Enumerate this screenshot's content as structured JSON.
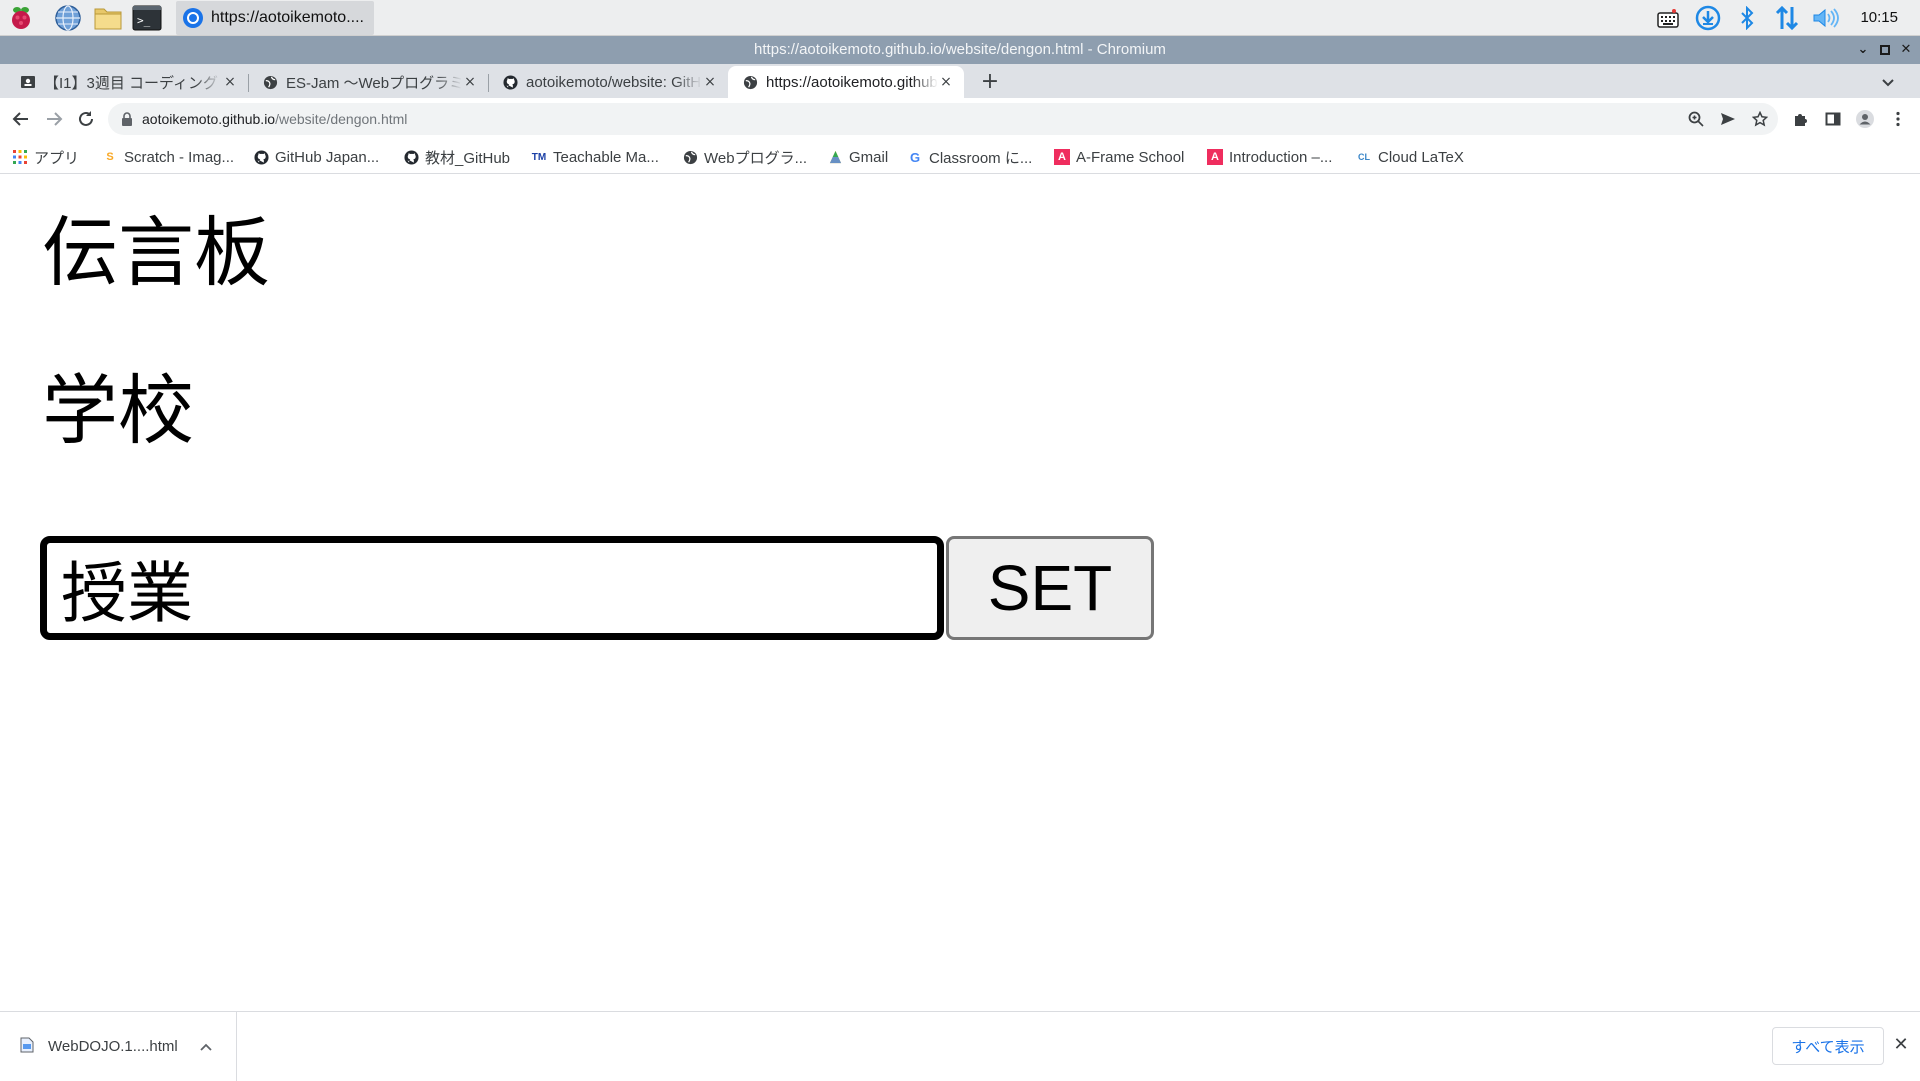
{
  "taskbar": {
    "launchers": [
      "raspberry-menu-icon",
      "web-browser-icon",
      "file-manager-icon",
      "terminal-icon"
    ],
    "active_task": "https://aotoikemoto....",
    "clock": "10:15"
  },
  "window": {
    "title": "https://aotoikemoto.github.io/website/dengon.html - Chromium"
  },
  "tabs": [
    {
      "title": "【I1】3週目 コーディング",
      "close": "×"
    },
    {
      "title": "ES-Jam 〜Webプログラミング",
      "close": "×"
    },
    {
      "title": "aotoikemoto/website: GitHub",
      "close": "×"
    },
    {
      "title": "https://aotoikemoto.github.io",
      "close": "×"
    }
  ],
  "new_tab_label": "+",
  "omnibox": {
    "host": "aotoikemoto.github.io",
    "path": "/website/dengon.html"
  },
  "bookmarks": [
    {
      "label": "アプリ",
      "icon": "apps-grid-icon"
    },
    {
      "label": "Scratch - Imag...",
      "icon": "scratch-icon"
    },
    {
      "label": "GitHub Japan...",
      "icon": "github-icon"
    },
    {
      "label": "教材_GitHub",
      "icon": "github-icon"
    },
    {
      "label": "Teachable Ma...",
      "icon": "teachable-machine-icon"
    },
    {
      "label": "Webプログラ...",
      "icon": "globe-icon"
    },
    {
      "label": "Gmail",
      "icon": "gmail-icon"
    },
    {
      "label": "Classroom に...",
      "icon": "google-icon"
    },
    {
      "label": "A-Frame School",
      "icon": "aframe-icon"
    },
    {
      "label": "Introduction –...",
      "icon": "aframe-icon"
    },
    {
      "label": "Cloud LaTeX",
      "icon": "cloud-latex-icon"
    }
  ],
  "page": {
    "heading": "伝言板",
    "message": "学校",
    "input_value": "授業",
    "set_button": "SET"
  },
  "downloads": {
    "filename": "WebDOJO.1....html",
    "show_all": "すべて表示"
  }
}
